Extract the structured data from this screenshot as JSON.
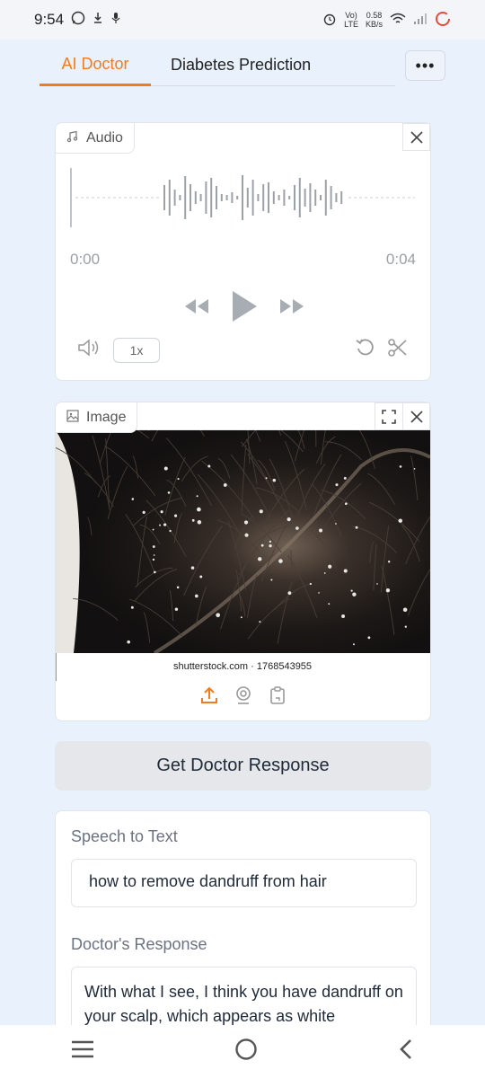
{
  "status": {
    "time": "9:54",
    "volte_top": "Vo)",
    "volte_bottom": "LTE",
    "speed_top": "0.58",
    "speed_bottom": "KB/s"
  },
  "tabs": [
    {
      "label": "AI Doctor",
      "active": true
    },
    {
      "label": "Diabetes Prediction",
      "active": false
    }
  ],
  "more_label": "•••",
  "audio": {
    "label": "Audio",
    "start_time": "0:00",
    "end_time": "0:04",
    "speed": "1x"
  },
  "image": {
    "label": "Image",
    "watermark": "shutterstock.com · 1768543955"
  },
  "action_button": "Get Doctor Response",
  "speech_to_text": {
    "label": "Speech to Text",
    "value": "how to remove dandruff from hair"
  },
  "doctor_response": {
    "label": "Doctor's Response",
    "value": "With what I see, I think you have dandruff on your scalp, which appears as white"
  },
  "colors": {
    "accent": "#f07c21",
    "background": "#e9f1fd"
  }
}
